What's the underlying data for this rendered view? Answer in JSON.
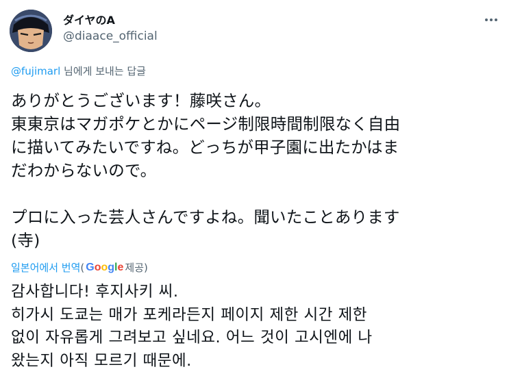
{
  "author": {
    "display_name": "ダイヤのA",
    "handle": "@diaace_official"
  },
  "reply_context": {
    "mention": "@fujimarl",
    "suffix": " 님에게 보내는 답글"
  },
  "tweet": {
    "text": "ありがとうございます！藤咲さん。\n東東京はマガポケとかにページ制限時間制限なく自由\nに描いてみたいですね。どっちが甲子園に出たかはま\nだわからないので。\n\nプロに入った芸人さんですよね。聞いたことあります\n(寺)"
  },
  "translation": {
    "link_label": "일본어에서 번역",
    "paren_open": "(",
    "provider_letters": [
      "G",
      "o",
      "o",
      "g",
      "l",
      "e"
    ],
    "provider_colors": [
      "#4285F4",
      "#EA4335",
      "#FBBC05",
      "#4285F4",
      "#34A853",
      "#EA4335"
    ],
    "provider_suffix": " 제공)",
    "text": "감사합니다! 후지사키 씨.\n히가시 도쿄는 매가 포케라든지 페이지 제한 시간 제한\n없이 자유롭게 그려보고 싶네요. 어느 것이 고시엔에 나\n왔는지 아직 모르기 때문에."
  },
  "icons": {
    "avatar": "avatar-illustration",
    "more": "more-options-icon"
  }
}
